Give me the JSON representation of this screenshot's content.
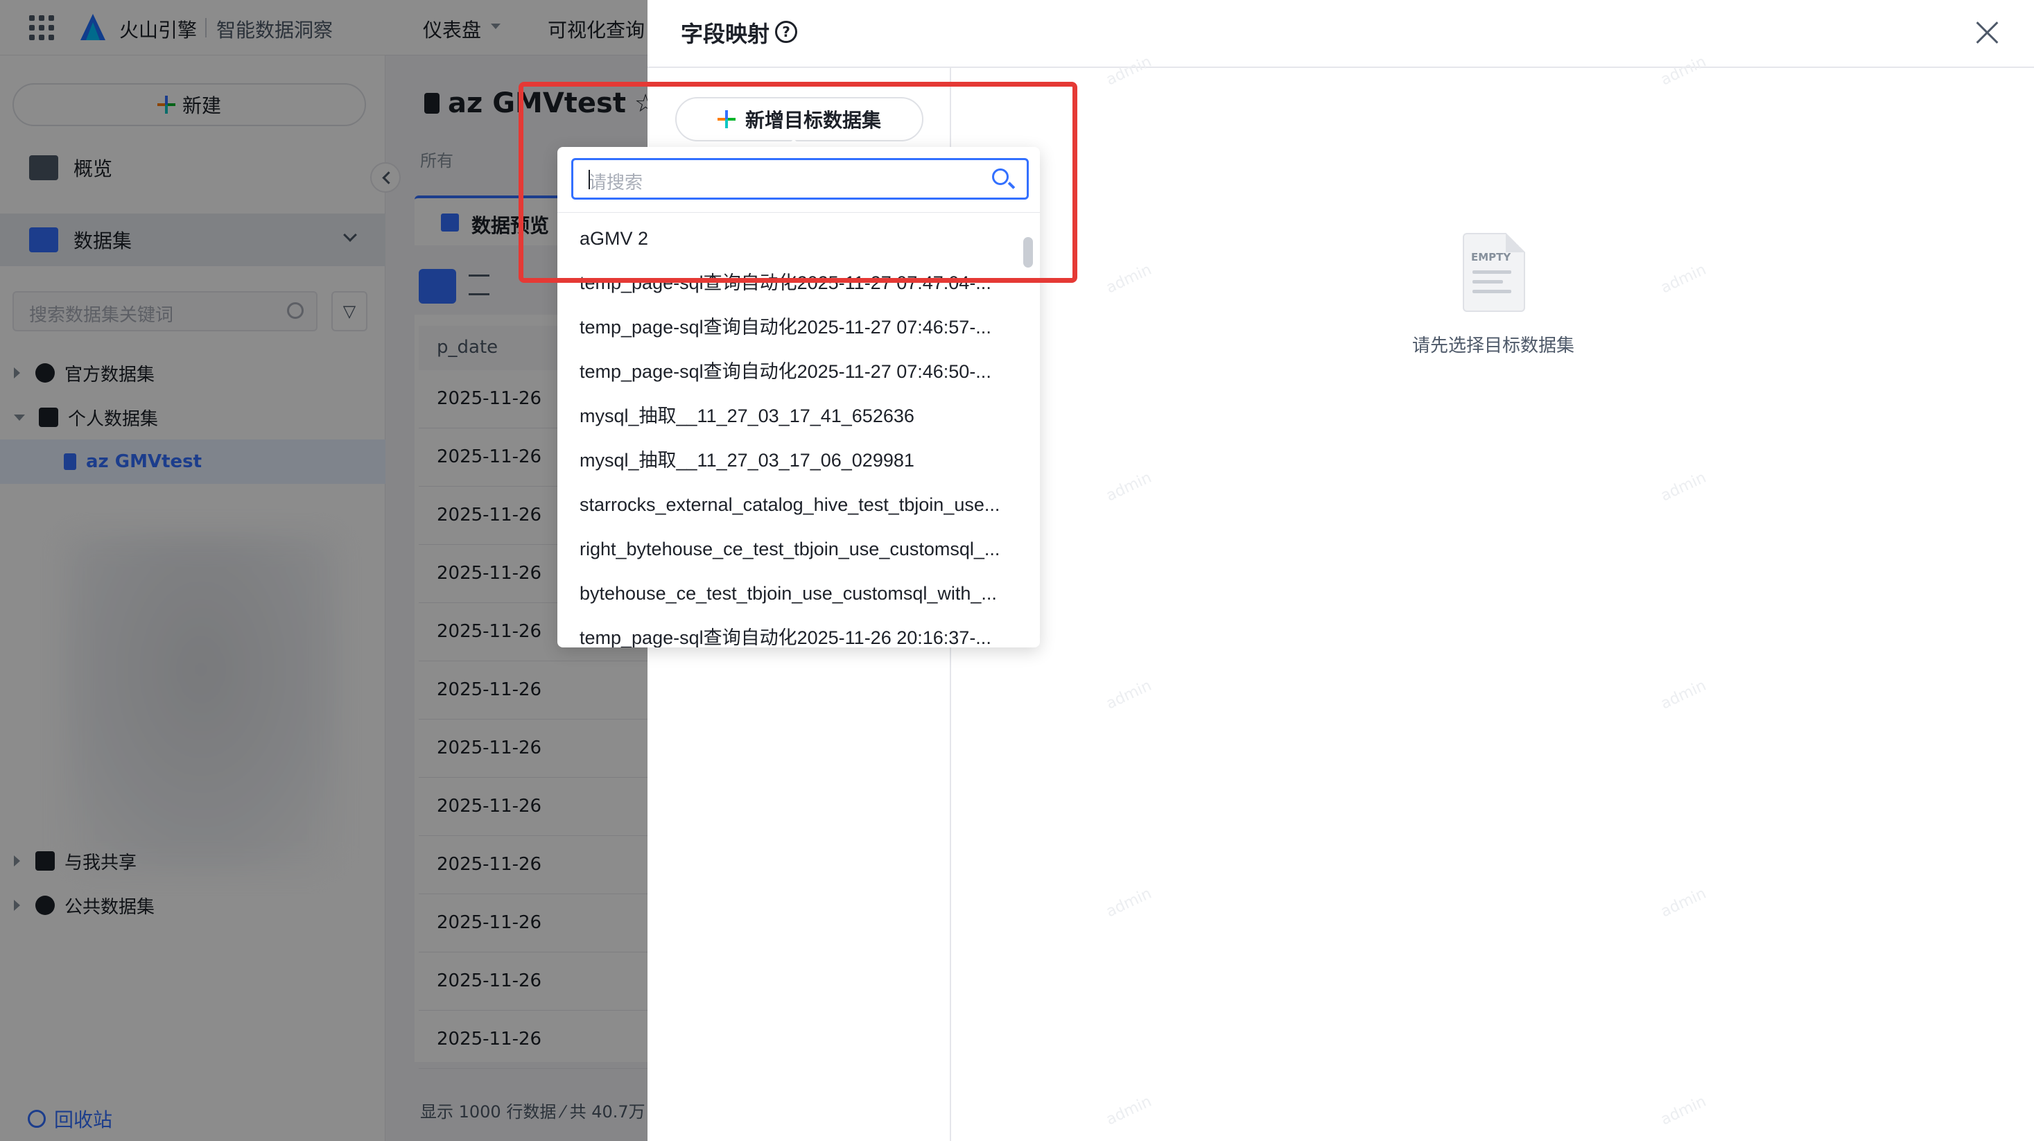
{
  "topbar": {
    "brand": "火山引擎",
    "product": "智能数据洞察",
    "nav": [
      "仪表盘",
      "可视化查询"
    ]
  },
  "sidebar": {
    "new_label": "新建",
    "overview_label": "概览",
    "dataset_label": "数据集",
    "search_placeholder": "搜索数据集关键词",
    "tree": {
      "official": "官方数据集",
      "personal": "个人数据集",
      "selected": "az GMVtest",
      "shared": "与我共享",
      "public": "公共数据集"
    },
    "recycle_label": "回收站"
  },
  "main": {
    "title": "az GMVtest",
    "owner_prefix": "所有",
    "tab_preview": "数据预览",
    "column_header": "p_date",
    "rows": [
      "2025-11-26",
      "2025-11-26",
      "2025-11-26",
      "2025-11-26",
      "2025-11-26",
      "2025-11-26",
      "2025-11-26",
      "2025-11-26",
      "2025-11-26",
      "2025-11-26",
      "2025-11-26",
      "2025-11-26"
    ],
    "footer": "显示 1000 行数据 ⁄ 共 40.7万"
  },
  "drawer": {
    "title": "字段映射",
    "help_symbol": "?",
    "add_target_label": "新增目标数据集",
    "empty_label": "EMPTY",
    "empty_text": "请先选择目标数据集",
    "watermark": "admin"
  },
  "dropdown": {
    "search_placeholder": "请搜索",
    "items": [
      "aGMV 2",
      "temp_page-sql查询自动化2025-11-27 07:47:04-...",
      "temp_page-sql查询自动化2025-11-27 07:46:57-...",
      "temp_page-sql查询自动化2025-11-27 07:46:50-...",
      "mysql_抽取__11_27_03_17_41_652636",
      "mysql_抽取__11_27_03_17_06_029981",
      "starrocks_external_catalog_hive_test_tbjoin_use...",
      "right_bytehouse_ce_test_tbjoin_use_customsql_...",
      "bytehouse_ce_test_tbjoin_use_customsql_with_...",
      "temp_page-sql查询自动化2025-11-26 20:16:37-..."
    ]
  },
  "colors": {
    "accent": "#3370ff",
    "annotation_red": "#e53935"
  }
}
